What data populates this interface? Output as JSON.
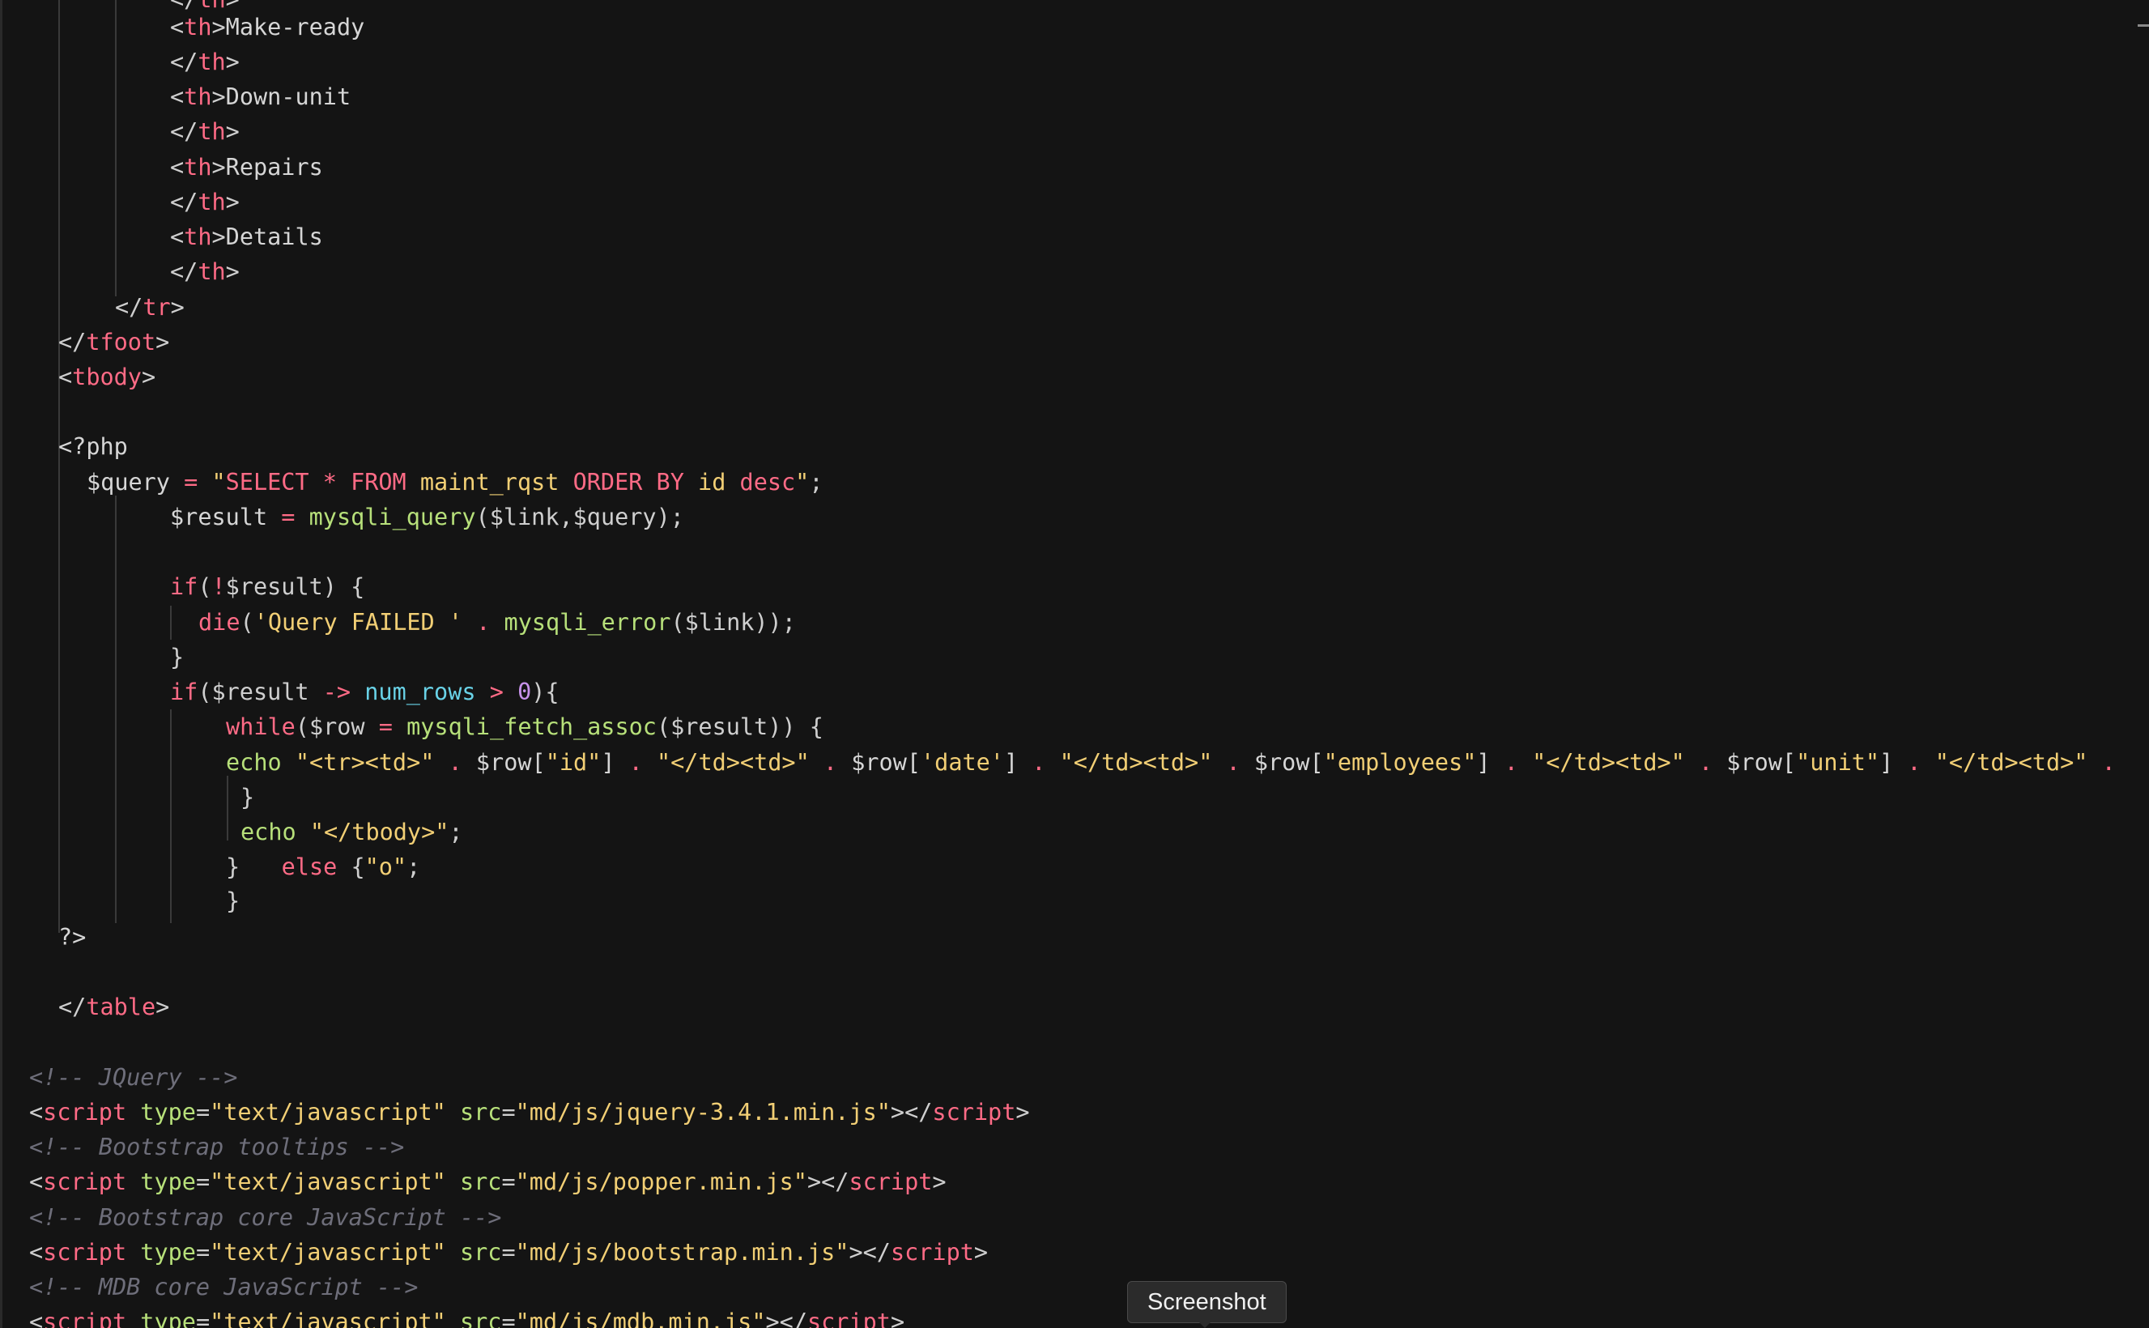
{
  "tooltip": {
    "label": "Screenshot"
  },
  "editor": {
    "language": "php",
    "theme_colors": {
      "background": "#141414",
      "tag": "#ff6b86",
      "attribute": "#b7e07a",
      "string": "#f2cf75",
      "function": "#b7e07a",
      "property": "#69d2e7",
      "number": "#c792ea",
      "comment": "#6e6e7a",
      "text": "#d6d6d6"
    }
  },
  "code": {
    "lines": [
      [
        {
          "t": "</",
          "c": "t-punc"
        },
        {
          "t": "th",
          "c": "t-tag"
        },
        {
          "t": ">",
          "c": "t-punc"
        }
      ],
      [
        {
          "t": "<",
          "c": "t-punc"
        },
        {
          "t": "th",
          "c": "t-tag"
        },
        {
          "t": ">",
          "c": "t-punc"
        },
        {
          "t": "Make-ready",
          "c": "t-text"
        }
      ],
      [
        {
          "t": "</",
          "c": "t-punc"
        },
        {
          "t": "th",
          "c": "t-tag"
        },
        {
          "t": ">",
          "c": "t-punc"
        }
      ],
      [
        {
          "t": "<",
          "c": "t-punc"
        },
        {
          "t": "th",
          "c": "t-tag"
        },
        {
          "t": ">",
          "c": "t-punc"
        },
        {
          "t": "Down-unit",
          "c": "t-text"
        }
      ],
      [
        {
          "t": "</",
          "c": "t-punc"
        },
        {
          "t": "th",
          "c": "t-tag"
        },
        {
          "t": ">",
          "c": "t-punc"
        }
      ],
      [
        {
          "t": "<",
          "c": "t-punc"
        },
        {
          "t": "th",
          "c": "t-tag"
        },
        {
          "t": ">",
          "c": "t-punc"
        },
        {
          "t": "Repairs",
          "c": "t-text"
        }
      ],
      [
        {
          "t": "</",
          "c": "t-punc"
        },
        {
          "t": "th",
          "c": "t-tag"
        },
        {
          "t": ">",
          "c": "t-punc"
        }
      ],
      [
        {
          "t": "<",
          "c": "t-punc"
        },
        {
          "t": "th",
          "c": "t-tag"
        },
        {
          "t": ">",
          "c": "t-punc"
        },
        {
          "t": "Details",
          "c": "t-text"
        }
      ],
      [
        {
          "t": "</",
          "c": "t-punc"
        },
        {
          "t": "th",
          "c": "t-tag"
        },
        {
          "t": ">",
          "c": "t-punc"
        }
      ],
      [
        {
          "t": "</",
          "c": "t-punc"
        },
        {
          "t": "tr",
          "c": "t-tag"
        },
        {
          "t": ">",
          "c": "t-punc"
        }
      ],
      [
        {
          "t": "</",
          "c": "t-punc"
        },
        {
          "t": "tfoot",
          "c": "t-tag"
        },
        {
          "t": ">",
          "c": "t-punc"
        }
      ],
      [
        {
          "t": "<",
          "c": "t-punc"
        },
        {
          "t": "tbody",
          "c": "t-tag"
        },
        {
          "t": ">",
          "c": "t-punc"
        }
      ],
      [],
      [
        {
          "t": "<?php",
          "c": "t-php"
        }
      ],
      [
        {
          "t": "$query ",
          "c": "t-var"
        },
        {
          "t": "=",
          "c": "t-op"
        },
        {
          "t": " ",
          "c": "t-text"
        },
        {
          "t": "\"",
          "c": "t-str"
        },
        {
          "t": "SELECT",
          "c": "t-kw"
        },
        {
          "t": " * ",
          "c": "t-op"
        },
        {
          "t": "FROM",
          "c": "t-kw"
        },
        {
          "t": " maint_rqst ",
          "c": "t-str"
        },
        {
          "t": "ORDER BY",
          "c": "t-kw"
        },
        {
          "t": " id ",
          "c": "t-str"
        },
        {
          "t": "desc",
          "c": "t-kw"
        },
        {
          "t": "\"",
          "c": "t-str"
        },
        {
          "t": ";",
          "c": "t-punc"
        }
      ],
      [
        {
          "t": "$result ",
          "c": "t-var"
        },
        {
          "t": "=",
          "c": "t-op"
        },
        {
          "t": " ",
          "c": "t-text"
        },
        {
          "t": "mysqli_query",
          "c": "t-fn"
        },
        {
          "t": "($link,$query);",
          "c": "t-punc"
        }
      ],
      [],
      [
        {
          "t": "if",
          "c": "t-kw"
        },
        {
          "t": "(",
          "c": "t-punc"
        },
        {
          "t": "!",
          "c": "t-op"
        },
        {
          "t": "$result) {",
          "c": "t-punc"
        }
      ],
      [
        {
          "t": "die",
          "c": "t-kw"
        },
        {
          "t": "(",
          "c": "t-punc"
        },
        {
          "t": "'Query FAILED '",
          "c": "t-str"
        },
        {
          "t": " . ",
          "c": "t-op"
        },
        {
          "t": "mysqli_error",
          "c": "t-fn"
        },
        {
          "t": "($link));",
          "c": "t-punc"
        }
      ],
      [
        {
          "t": "}",
          "c": "t-punc"
        }
      ],
      [
        {
          "t": "if",
          "c": "t-kw"
        },
        {
          "t": "($result ",
          "c": "t-punc"
        },
        {
          "t": "->",
          "c": "t-op"
        },
        {
          "t": " ",
          "c": "t-text"
        },
        {
          "t": "num_rows",
          "c": "t-prop"
        },
        {
          "t": " ",
          "c": "t-text"
        },
        {
          "t": ">",
          "c": "t-op"
        },
        {
          "t": " ",
          "c": "t-text"
        },
        {
          "t": "0",
          "c": "t-num"
        },
        {
          "t": "){",
          "c": "t-punc"
        }
      ],
      [
        {
          "t": "while",
          "c": "t-kw"
        },
        {
          "t": "($row ",
          "c": "t-punc"
        },
        {
          "t": "=",
          "c": "t-op"
        },
        {
          "t": " ",
          "c": "t-text"
        },
        {
          "t": "mysqli_fetch_assoc",
          "c": "t-fn"
        },
        {
          "t": "($result)) {",
          "c": "t-punc"
        }
      ],
      [
        {
          "t": "echo",
          "c": "t-fn"
        },
        {
          "t": " ",
          "c": "t-text"
        },
        {
          "t": "\"<tr><td>\"",
          "c": "t-str"
        },
        {
          "t": " . ",
          "c": "t-op"
        },
        {
          "t": "$row[",
          "c": "t-var"
        },
        {
          "t": "\"id\"",
          "c": "t-str"
        },
        {
          "t": "]",
          "c": "t-var"
        },
        {
          "t": " . ",
          "c": "t-op"
        },
        {
          "t": "\"</td><td>\"",
          "c": "t-str"
        },
        {
          "t": " . ",
          "c": "t-op"
        },
        {
          "t": "$row[",
          "c": "t-var"
        },
        {
          "t": "'date'",
          "c": "t-str"
        },
        {
          "t": "]",
          "c": "t-var"
        },
        {
          "t": " . ",
          "c": "t-op"
        },
        {
          "t": "\"</td><td>\"",
          "c": "t-str"
        },
        {
          "t": " . ",
          "c": "t-op"
        },
        {
          "t": "$row[",
          "c": "t-var"
        },
        {
          "t": "\"employees\"",
          "c": "t-str"
        },
        {
          "t": "]",
          "c": "t-var"
        },
        {
          "t": " . ",
          "c": "t-op"
        },
        {
          "t": "\"</td><td>\"",
          "c": "t-str"
        },
        {
          "t": " . ",
          "c": "t-op"
        },
        {
          "t": "$row[",
          "c": "t-var"
        },
        {
          "t": "\"unit\"",
          "c": "t-str"
        },
        {
          "t": "]",
          "c": "t-var"
        },
        {
          "t": " . ",
          "c": "t-op"
        },
        {
          "t": "\"</td><td>\"",
          "c": "t-str"
        },
        {
          "t": " .",
          "c": "t-op"
        }
      ],
      [
        {
          "t": "}",
          "c": "t-punc"
        }
      ],
      [
        {
          "t": "echo",
          "c": "t-fn"
        },
        {
          "t": " ",
          "c": "t-text"
        },
        {
          "t": "\"</tbody>\"",
          "c": "t-str"
        },
        {
          "t": ";",
          "c": "t-punc"
        }
      ],
      [
        {
          "t": "}   ",
          "c": "t-punc"
        },
        {
          "t": "else",
          "c": "t-kw"
        },
        {
          "t": " {",
          "c": "t-punc"
        },
        {
          "t": "\"o\"",
          "c": "t-str"
        },
        {
          "t": ";",
          "c": "t-punc"
        }
      ],
      [
        {
          "t": "}",
          "c": "t-punc"
        }
      ],
      [
        {
          "t": "?>",
          "c": "t-php"
        }
      ],
      [],
      [
        {
          "t": "</",
          "c": "t-punc"
        },
        {
          "t": "table",
          "c": "t-tag"
        },
        {
          "t": ">",
          "c": "t-punc"
        }
      ],
      [],
      [
        {
          "t": "<!-- JQuery -->",
          "c": "t-comment"
        }
      ],
      [
        {
          "t": "<",
          "c": "t-punc"
        },
        {
          "t": "script",
          "c": "t-tag"
        },
        {
          "t": " ",
          "c": "t-text"
        },
        {
          "t": "type",
          "c": "t-attr"
        },
        {
          "t": "=",
          "c": "t-punc"
        },
        {
          "t": "\"text/javascript\"",
          "c": "t-str"
        },
        {
          "t": " ",
          "c": "t-text"
        },
        {
          "t": "src",
          "c": "t-attr"
        },
        {
          "t": "=",
          "c": "t-punc"
        },
        {
          "t": "\"md/js/jquery-3.4.1.min.js\"",
          "c": "t-str"
        },
        {
          "t": "></",
          "c": "t-punc"
        },
        {
          "t": "script",
          "c": "t-tag"
        },
        {
          "t": ">",
          "c": "t-punc"
        }
      ],
      [
        {
          "t": "<!-- Bootstrap tooltips -->",
          "c": "t-comment"
        }
      ],
      [
        {
          "t": "<",
          "c": "t-punc"
        },
        {
          "t": "script",
          "c": "t-tag"
        },
        {
          "t": " ",
          "c": "t-text"
        },
        {
          "t": "type",
          "c": "t-attr"
        },
        {
          "t": "=",
          "c": "t-punc"
        },
        {
          "t": "\"text/javascript\"",
          "c": "t-str"
        },
        {
          "t": " ",
          "c": "t-text"
        },
        {
          "t": "src",
          "c": "t-attr"
        },
        {
          "t": "=",
          "c": "t-punc"
        },
        {
          "t": "\"md/js/popper.min.js\"",
          "c": "t-str"
        },
        {
          "t": "></",
          "c": "t-punc"
        },
        {
          "t": "script",
          "c": "t-tag"
        },
        {
          "t": ">",
          "c": "t-punc"
        }
      ],
      [
        {
          "t": "<!-- Bootstrap core JavaScript -->",
          "c": "t-comment"
        }
      ],
      [
        {
          "t": "<",
          "c": "t-punc"
        },
        {
          "t": "script",
          "c": "t-tag"
        },
        {
          "t": " ",
          "c": "t-text"
        },
        {
          "t": "type",
          "c": "t-attr"
        },
        {
          "t": "=",
          "c": "t-punc"
        },
        {
          "t": "\"text/javascript\"",
          "c": "t-str"
        },
        {
          "t": " ",
          "c": "t-text"
        },
        {
          "t": "src",
          "c": "t-attr"
        },
        {
          "t": "=",
          "c": "t-punc"
        },
        {
          "t": "\"md/js/bootstrap.min.js\"",
          "c": "t-str"
        },
        {
          "t": "></",
          "c": "t-punc"
        },
        {
          "t": "script",
          "c": "t-tag"
        },
        {
          "t": ">",
          "c": "t-punc"
        }
      ],
      [
        {
          "t": "<!-- MDB core JavaScript -->",
          "c": "t-comment"
        }
      ],
      [
        {
          "t": "<",
          "c": "t-punc"
        },
        {
          "t": "script",
          "c": "t-tag"
        },
        {
          "t": " ",
          "c": "t-text"
        },
        {
          "t": "type",
          "c": "t-attr"
        },
        {
          "t": "=",
          "c": "t-punc"
        },
        {
          "t": "\"text/javascript\"",
          "c": "t-str"
        },
        {
          "t": " ",
          "c": "t-text"
        },
        {
          "t": "src",
          "c": "t-attr"
        },
        {
          "t": "=",
          "c": "t-punc"
        },
        {
          "t": "\"md/js/mdb.min.js\"",
          "c": "t-str"
        },
        {
          "t": "></",
          "c": "t-punc"
        },
        {
          "t": "script",
          "c": "t-tag"
        },
        {
          "t": ">",
          "c": "t-punc"
        }
      ]
    ]
  }
}
